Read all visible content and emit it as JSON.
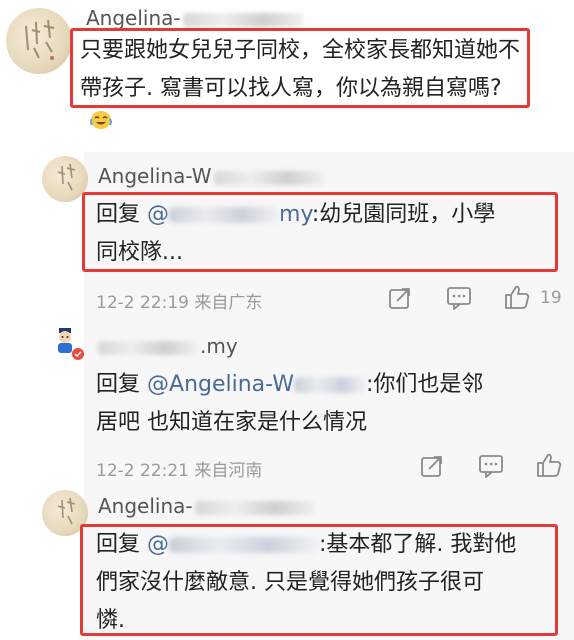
{
  "comment_top": {
    "author": "Angelina-",
    "text_line1": "只要跟她女兒兒子同校，全校家長都知道她不",
    "text_line2": "帶孩子. 寫書可以找人寫，你以為親自寫嗎?"
  },
  "reply1": {
    "author": "Angelina-W",
    "prefix": "回复",
    "mention": "@",
    "mention_tail": "my",
    "text_rest": ":幼兒園同班，小學",
    "text_line2": "同校隊...",
    "time": "12-2 22:19",
    "source": "来自广东",
    "likes": "19"
  },
  "reply2": {
    "author": ".my",
    "prefix": "回复",
    "mention": "@Angelina-W",
    "text_rest": ":你们也是邻",
    "text_line2": "居吧 也知道在家是什么情况",
    "time": "12-2 22:21",
    "source": "来自河南"
  },
  "reply3": {
    "author": "Angelina-",
    "prefix": "回复",
    "mention": "@",
    "text_rest": ":基本都了解. 我對他",
    "text_line2": "們家沒什麼敵意. 只是覺得她們孩子很可",
    "text_line3": "憐."
  },
  "icons": {
    "share": "share-icon",
    "comment": "comment-icon",
    "like": "thumbs-up-icon",
    "emoji": "laughing-crying-emoji-icon",
    "badge": "verified-badge-icon"
  },
  "colors": {
    "highlight": "#e53935",
    "link": "#4a6a96",
    "meta": "#9a9a9a"
  }
}
